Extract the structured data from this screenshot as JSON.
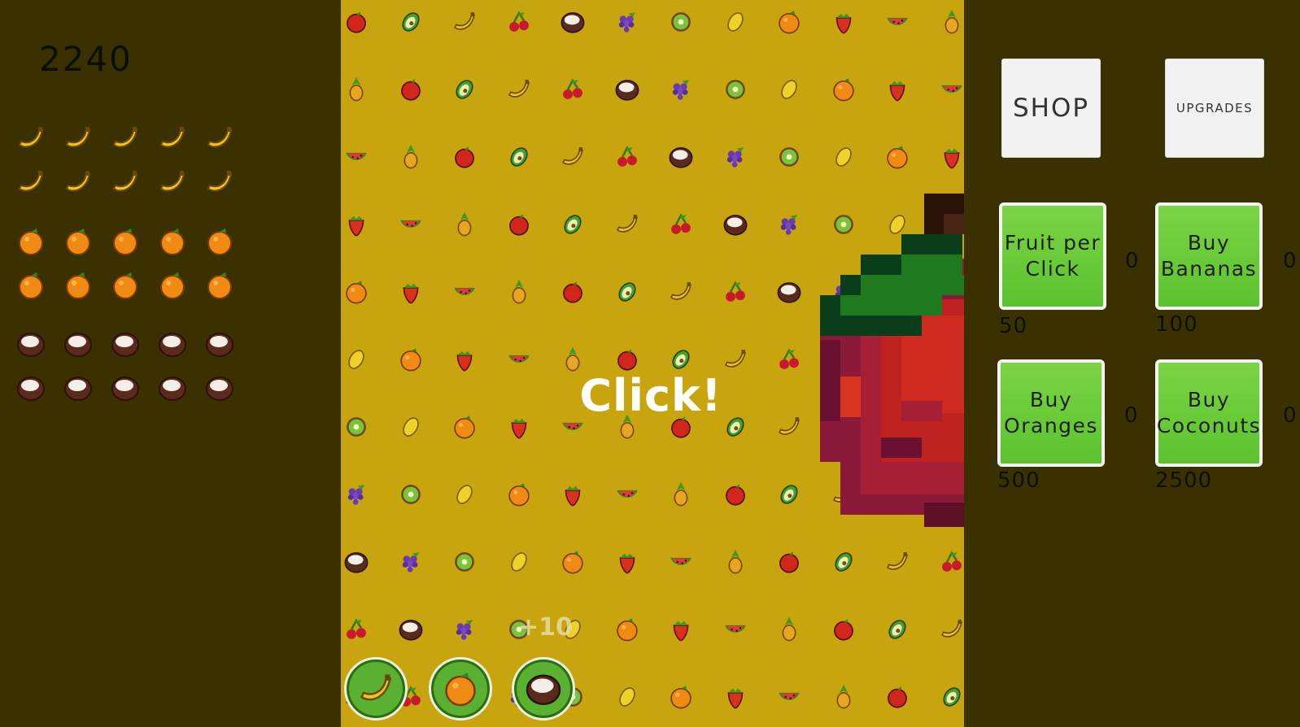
{
  "score": "2240",
  "inventory": {
    "bananas": 10,
    "oranges": 10,
    "coconuts": 10
  },
  "center": {
    "click_label": "Click!",
    "float_text": "+10",
    "background_fruit_icons": [
      "apple-icon",
      "avocado-icon",
      "banana-icon",
      "cherry-icon",
      "coconut-icon",
      "grape-icon",
      "kiwi-icon",
      "lemon-icon",
      "orange-icon",
      "strawberry-icon",
      "watermelon-icon",
      "pineapple-icon"
    ],
    "quick_buttons": [
      "banana-icon",
      "orange-icon",
      "coconut-icon"
    ]
  },
  "right": {
    "shop_label": "SHOP",
    "upgrades_label": "UPGRADES",
    "items": [
      {
        "label_line1": "Fruit per",
        "label_line2": "Click",
        "count": "0",
        "price": "50"
      },
      {
        "label_line1": "Buy",
        "label_line2": "Bananas",
        "count": "0",
        "price": "100"
      },
      {
        "label_line1": "Buy",
        "label_line2": "Oranges",
        "count": "0",
        "price": "500"
      },
      {
        "label_line1": "Buy",
        "label_line2": "Coconuts",
        "count": "0",
        "price": "2500"
      }
    ]
  },
  "colors": {
    "panel_bg": "#3b3100",
    "field_bg": "#c8a50f",
    "button_green": "#6fcf3a",
    "apple_red": "#b5211c"
  }
}
